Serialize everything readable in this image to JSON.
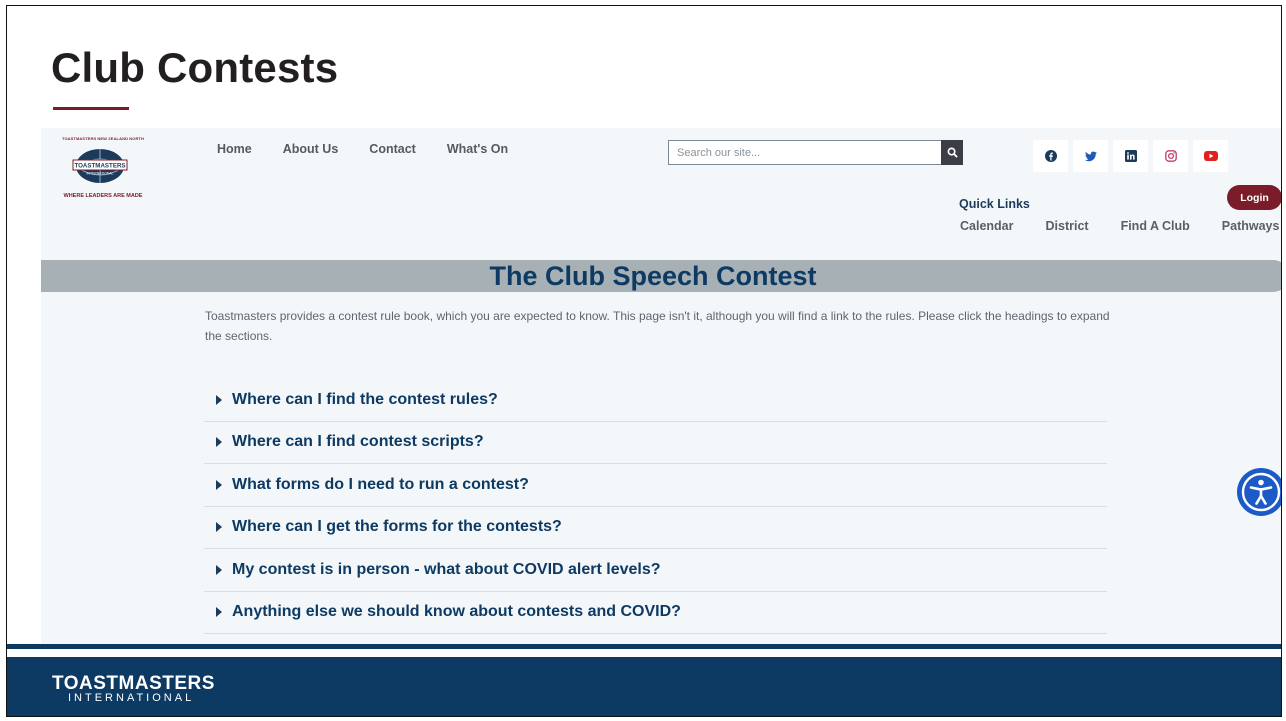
{
  "slide": {
    "title": "Club Contests"
  },
  "site": {
    "logo": {
      "top_text": "TOASTMASTERS NEW ZEALAND NORTH",
      "banner_text": "TOASTMASTERS",
      "sub_text": "INTERNATIONAL",
      "tagline": "WHERE LEADERS ARE MADE"
    },
    "nav": [
      "Home",
      "About Us",
      "Contact",
      "What's On"
    ],
    "search": {
      "placeholder": "Search our site..."
    },
    "social_icons": [
      "facebook-icon",
      "twitter-icon",
      "linkedin-icon",
      "instagram-icon",
      "youtube-icon"
    ],
    "quick_links_label": "Quick Links",
    "login_label": "Login",
    "quick_links": [
      "Calendar",
      "District",
      "Find A Club",
      "Pathways"
    ],
    "colors": {
      "brand_maroon": "#7b1c2a",
      "brand_navy": "#0d3a63",
      "banner_grey": "#a6b0b5"
    }
  },
  "page": {
    "heading": "The Club Speech Contest",
    "intro": "Toastmasters provides a contest rule book, which you are expected to know. This page isn't it, although you will find a link to the rules. Please click the headings to expand the sections.",
    "faq": [
      "Where can I find the contest rules?",
      "Where can I find contest scripts?",
      "What forms do I need to run a contest?",
      "Where can I get the forms for the contests?",
      "My contest is in person - what about COVID alert levels?",
      "Anything else we should know about contests and COVID?"
    ]
  },
  "footer": {
    "brand_line1": "TOASTMASTERS",
    "brand_line2": "INTERNATIONAL"
  }
}
